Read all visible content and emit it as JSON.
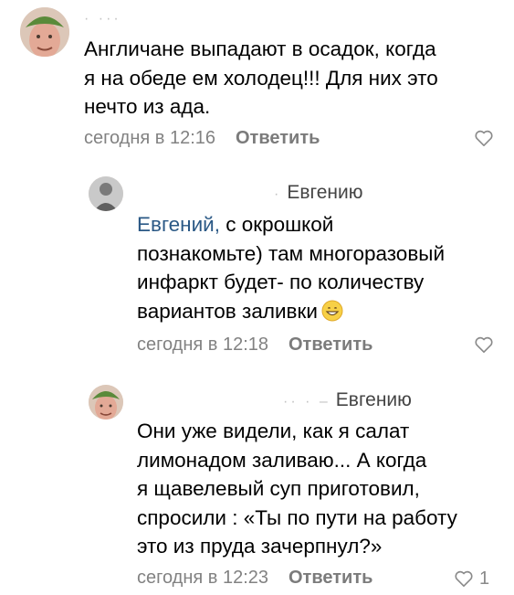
{
  "comments": [
    {
      "avatar": "green-hat-man-avatar",
      "author_blur": "·   ···",
      "lines": [
        "Англичане выпадают в осадок, когда",
        "я на обеде ем холодец!!! Для них это",
        "нечто из ада."
      ],
      "time": "сегодня в 12:16",
      "reply_label": "Ответить",
      "likes": ""
    },
    {
      "avatar": "grey-photo-avatar",
      "author_blur": "·",
      "reply_to": "Евгению",
      "mention": "Евгений,",
      "first_rest": " с окрошкой",
      "lines": [
        "познакомьте) там многоразовый",
        "инфаркт будет- по количеству",
        "вариантов заливки"
      ],
      "emoji": "grinning-face-emoji",
      "time": "сегодня в 12:18",
      "reply_label": "Ответить",
      "likes": ""
    },
    {
      "avatar": "green-hat-man-avatar",
      "author_blur": "··  · –",
      "reply_to": "Евгению",
      "lines": [
        "Они уже видели, как я салат",
        "лимонадом заливаю... А когда",
        "я щавелевый суп приготовил,",
        "спросили : «Ты по пути на работу",
        "это из пруда зачерпнул?»"
      ],
      "time": "сегодня в 12:23",
      "reply_label": "Ответить",
      "likes": "1"
    }
  ],
  "icons": {
    "like": "heart-outline-icon"
  },
  "colors": {
    "mention": "#2a5885",
    "meta": "#828282",
    "like": "#8a8a8a"
  }
}
